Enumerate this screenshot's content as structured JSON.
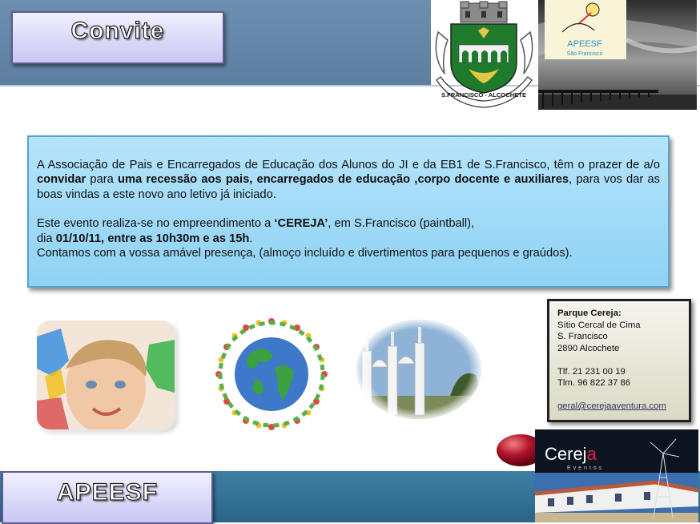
{
  "header": {
    "title": "Convite"
  },
  "crest": {
    "scroll_text": "S.FRANCISCO - ALCOCHETE"
  },
  "logo": {
    "name": "APEESF",
    "subtitle": "São Francisco"
  },
  "invitation": {
    "p1_a": "A Associação de Pais e Encarregados de Educação dos Alunos do JI e da EB1 de S.Francisco, têm o prazer de a/o ",
    "p1_b": "convidar",
    "p1_c": " para ",
    "p1_d": "uma recessão aos pais, encarregados de educação ,corpo docente e auxiliares",
    "p1_e": ", para vos dar as boas vindas a este novo ano letivo já iniciado.",
    "p2_a": "Este evento realiza-se no empreendimento a ",
    "p2_b": "‘CEREJA’",
    "p2_c": ", em S.Francisco (paintball),",
    "p3_a": "dia ",
    "p3_b": "01/10/11, entre as 10h30m e as 15h",
    "p3_c": ".",
    "p4": "Contamos com a vossa amável presença, (almoço incluído e divertimentos para pequenos e graúdos)."
  },
  "address": {
    "title": "Parque Cereja:",
    "line1": "Sítio Cercal de Cima",
    "line2": "S. Francisco",
    "line3": "2890 Alcochete",
    "phone": "Tlf. 21 231 00 19",
    "mobile": "Tlm. 96 822 37 86",
    "email": "geral@cerejaaventura.com"
  },
  "footer": {
    "title": "APEESF"
  },
  "cereja": {
    "brand_a": "Cerej",
    "brand_b": "a",
    "tagline": "Eventos"
  },
  "colors": {
    "header_band": "#6c8fb0",
    "invite_box": "#a8def8",
    "footer_band": "#2f6f95",
    "cherry": "#b0142a"
  }
}
